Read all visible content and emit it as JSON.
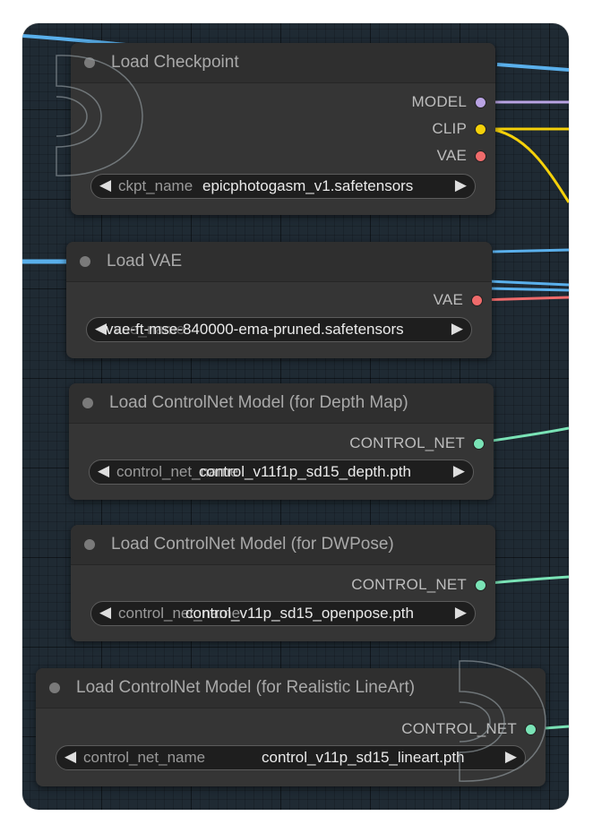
{
  "colors": {
    "model": "#b9a3e3",
    "clip": "#f5d10a",
    "vae": "#ef6b6b",
    "control_net": "#7ae3b6",
    "wire_blue": "#5ab0ec"
  },
  "nodes": [
    {
      "title": "Load Checkpoint",
      "outputs": [
        {
          "label": "MODEL",
          "type": "model"
        },
        {
          "label": "CLIP",
          "type": "clip"
        },
        {
          "label": "VAE",
          "type": "vae"
        }
      ],
      "widget": {
        "name": "ckpt_name",
        "value": "epicphotogasm_v1.safetensors"
      }
    },
    {
      "title": "Load VAE",
      "outputs": [
        {
          "label": "VAE",
          "type": "vae"
        }
      ],
      "widget": {
        "name": "vae_name",
        "value": "vae-ft-mse-840000-ema-pruned.safetensors"
      }
    },
    {
      "title": "Load ControlNet Model (for Depth Map)",
      "outputs": [
        {
          "label": "CONTROL_NET",
          "type": "control_net"
        }
      ],
      "widget": {
        "name": "control_net_name",
        "value": "control_v11f1p_sd15_depth.pth"
      }
    },
    {
      "title": "Load ControlNet Model (for DWPose)",
      "outputs": [
        {
          "label": "CONTROL_NET",
          "type": "control_net"
        }
      ],
      "widget": {
        "name": "control_net_name",
        "value": "control_v11p_sd15_openpose.pth"
      }
    },
    {
      "title": "Load ControlNet Model (for Realistic LineArt)",
      "outputs": [
        {
          "label": "CONTROL_NET",
          "type": "control_net"
        }
      ],
      "widget": {
        "name": "control_net_name",
        "value": "control_v11p_sd15_lineart.pth"
      }
    }
  ],
  "icons": {
    "widget_left": "◀",
    "widget_right": "▶",
    "watermark": "watermark-logo-icon"
  }
}
